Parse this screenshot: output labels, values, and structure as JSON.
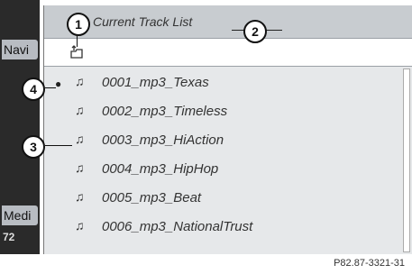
{
  "sidebar": {
    "navi_label": "Navi",
    "media_label": "Medi",
    "number": "72"
  },
  "header": {
    "title": "Current Track List"
  },
  "path": {
    "icon": "folder-up-icon"
  },
  "tracks": [
    {
      "label": "0001_mp3_Texas",
      "icon": "music-note-icon",
      "current": true
    },
    {
      "label": "0002_mp3_Timeless",
      "icon": "music-note-icon",
      "current": false
    },
    {
      "label": "0003_mp3_HiAction",
      "icon": "music-note-icon",
      "current": false
    },
    {
      "label": "0004_mp3_HipHop",
      "icon": "music-note-icon",
      "current": false
    },
    {
      "label": "0005_mp3_Beat",
      "icon": "music-note-icon",
      "current": false
    },
    {
      "label": "0006_mp3_NationalTrust",
      "icon": "music-note-icon",
      "current": false
    }
  ],
  "callouts": {
    "c1": "1",
    "c2": "2",
    "c3": "3",
    "c4": "4"
  },
  "reference": "P82.87-3321-31"
}
